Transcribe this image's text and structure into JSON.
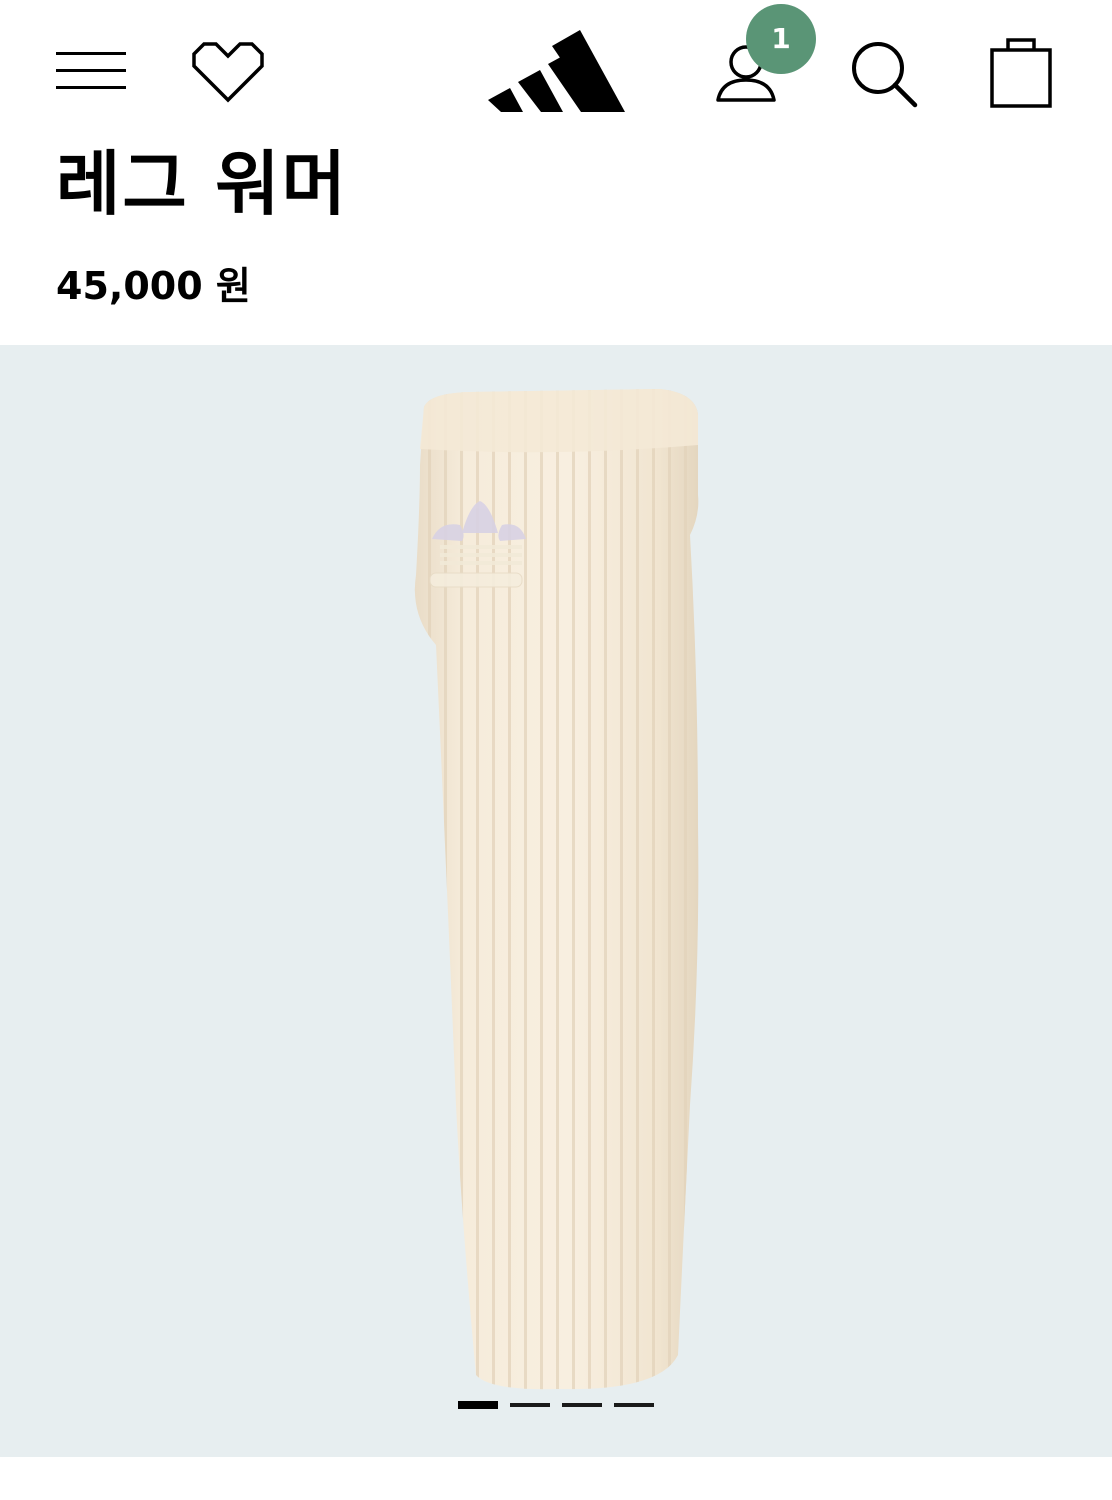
{
  "header": {
    "icons": {
      "menu": "menu-icon",
      "wishlist": "heart-icon",
      "logo": "adidas-logo",
      "account": "user-icon",
      "search": "search-icon",
      "bag": "shopping-bag-icon"
    },
    "account_badge_count": "1",
    "badge_color": "#5a9576"
  },
  "product": {
    "title": "레그 워머",
    "price": "45,000 원",
    "image_bg": "#e7eef0",
    "image_subject": "cream ribbed knit leg warmer with trefoil logo"
  },
  "gallery": {
    "image_count": 4,
    "active_index": 0
  }
}
